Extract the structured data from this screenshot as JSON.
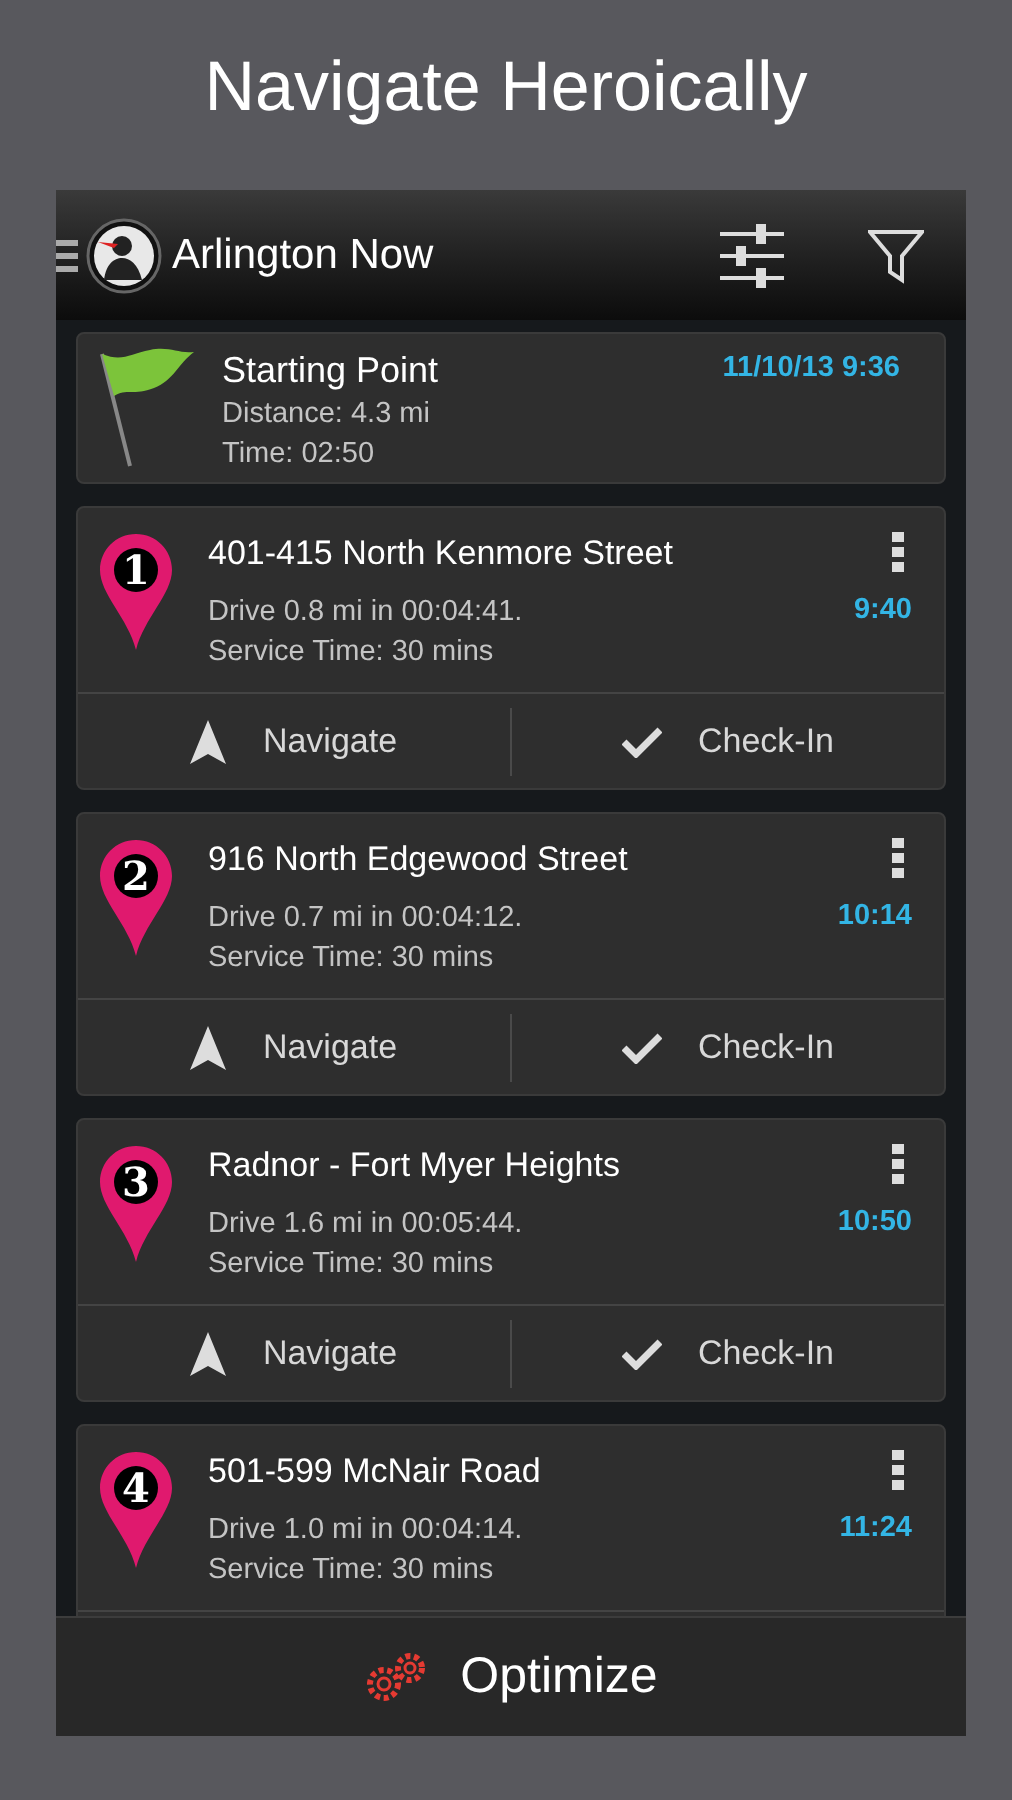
{
  "promo_title": "Navigate Heroically",
  "app_bar": {
    "title": "Arlington Now"
  },
  "start": {
    "title": "Starting Point",
    "distance": "Distance: 4.3 mi",
    "time": "Time: 02:50",
    "timestamp": "11/10/13 9:36"
  },
  "stops": [
    {
      "number": "1",
      "address": "401-415 North Kenmore Street",
      "drive": "Drive 0.8 mi in 00:04:41.",
      "service": "Service Time: 30 mins",
      "eta": "9:40",
      "actions": [
        "Navigate",
        "Check-In"
      ]
    },
    {
      "number": "2",
      "address": "916 North Edgewood Street",
      "drive": "Drive 0.7 mi in 00:04:12.",
      "service": "Service Time: 30 mins",
      "eta": "10:14",
      "actions": [
        "Navigate",
        "Check-In"
      ]
    },
    {
      "number": "3",
      "address": "Radnor - Fort Myer Heights",
      "drive": "Drive 1.6 mi in 00:05:44.",
      "service": "Service Time: 30 mins",
      "eta": "10:50",
      "actions": [
        "Navigate",
        "Check-In"
      ]
    },
    {
      "number": "4",
      "address": "501-599 McNair Road",
      "drive": "Drive 1.0 mi in 00:04:14.",
      "service": "Service Time: 30 mins",
      "eta": "11:24"
    }
  ],
  "bottom_button": "Optimize"
}
